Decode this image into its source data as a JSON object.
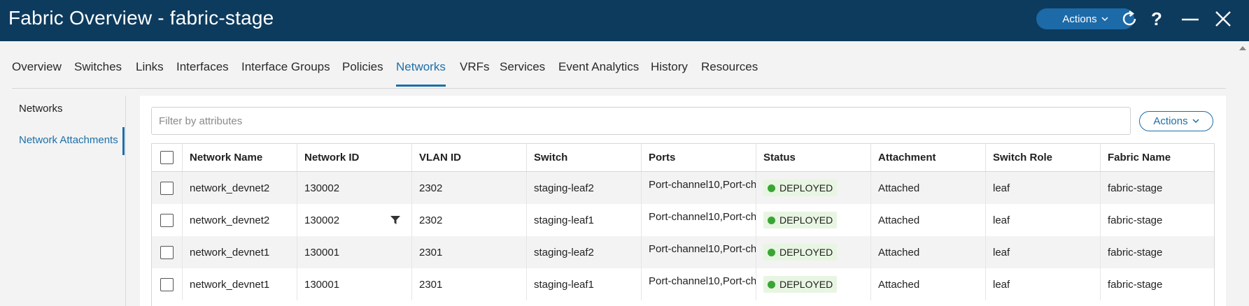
{
  "header": {
    "title": "Fabric Overview - fabric-stage",
    "actions_label": "Actions",
    "icons": [
      "refresh-icon",
      "help-icon",
      "minimize-icon",
      "close-icon"
    ]
  },
  "tabs": [
    "Overview",
    "Switches",
    "Links",
    "Interfaces",
    "Interface Groups",
    "Policies",
    "Networks",
    "VRFs",
    "Services",
    "Event Analytics",
    "History",
    "Resources"
  ],
  "active_tab": "Networks",
  "sidebar": {
    "items": [
      "Networks",
      "Network Attachments"
    ],
    "active": "Network Attachments"
  },
  "filter": {
    "placeholder": "Filter by attributes",
    "value": ""
  },
  "actions_button": "Actions",
  "table": {
    "columns": [
      "Network Name",
      "Network ID",
      "VLAN ID",
      "Switch",
      "Ports",
      "Status",
      "Attachment",
      "Switch Role",
      "Fabric Name"
    ],
    "rows": [
      [
        "network_devnet2",
        "130002",
        "2302",
        "staging-leaf2",
        "Port-channel10,Port-ch",
        "DEPLOYED",
        "Attached",
        "leaf",
        "fabric-stage"
      ],
      [
        "network_devnet2",
        "130002",
        "2302",
        "staging-leaf1",
        "Port-channel10,Port-ch",
        "DEPLOYED",
        "Attached",
        "leaf",
        "fabric-stage"
      ],
      [
        "network_devnet1",
        "130001",
        "2301",
        "staging-leaf2",
        "Port-channel10,Port-ch",
        "DEPLOYED",
        "Attached",
        "leaf",
        "fabric-stage"
      ],
      [
        "network_devnet1",
        "130001",
        "2301",
        "staging-leaf1",
        "Port-channel10,Port-ch",
        "DEPLOYED",
        "Attached",
        "leaf",
        "fabric-stage"
      ]
    ]
  },
  "colors": {
    "header_bg": "#0d3b5e",
    "accent": "#1d6fa8",
    "status_deployed": "#3aa535"
  }
}
